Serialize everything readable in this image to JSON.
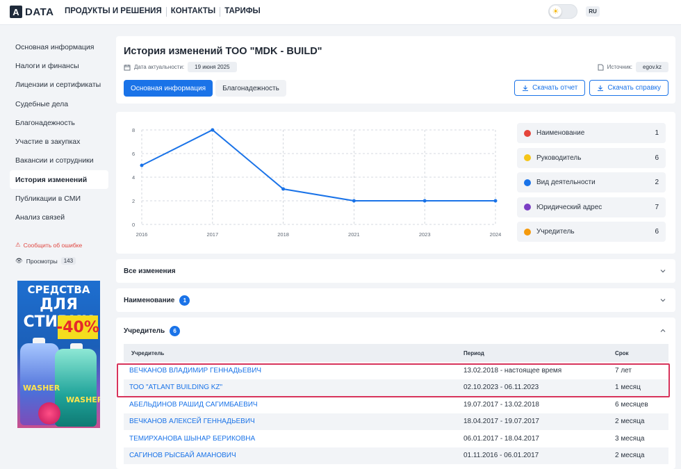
{
  "header": {
    "logo_mark": "A",
    "logo_text": "DATA",
    "nav": [
      "ПРОДУКТЫ И РЕШЕНИЯ",
      "КОНТАКТЫ",
      "ТАРИФЫ"
    ],
    "lang": "RU"
  },
  "sidebar": {
    "items": [
      {
        "label": "Основная информация",
        "active": false
      },
      {
        "label": "Налоги и финансы",
        "active": false
      },
      {
        "label": "Лицензии и сертификаты",
        "active": false
      },
      {
        "label": "Судебные дела",
        "active": false
      },
      {
        "label": "Благонадежность",
        "active": false
      },
      {
        "label": "Участие в закупках",
        "active": false
      },
      {
        "label": "Вакансии и сотрудники",
        "active": false
      },
      {
        "label": "История изменений",
        "active": true
      },
      {
        "label": "Публикации в СМИ",
        "active": false
      },
      {
        "label": "Анализ связей",
        "active": false
      }
    ],
    "report": "Сообщить об ошибке",
    "views_label": "Просмотры",
    "views_count": "143",
    "ad": {
      "line1": "СРЕДСТВА",
      "line2": "ДЛЯ СТИРКИ",
      "discount": "-40%",
      "brand": "WASHER"
    }
  },
  "main": {
    "title": "История изменений ТОО \"MDK - BUILD\"",
    "date_label": "Дата актуальности:",
    "date_value": "19 июня 2025",
    "source_label": "Источник:",
    "source_value": "egov.kz",
    "tabs": [
      "Основная информация",
      "Благонадежность"
    ],
    "download_report": "Скачать отчет",
    "download_certificate": "Скачать справку"
  },
  "chart_data": {
    "type": "line",
    "x": [
      "2016",
      "2017",
      "2018",
      "2021",
      "2023",
      "2024"
    ],
    "values": [
      5,
      8,
      3,
      2,
      2,
      2
    ],
    "ylim": [
      0,
      8
    ],
    "yticks": [
      "0",
      "2",
      "4",
      "6",
      "8"
    ],
    "grid": true,
    "color": "#1a73e8"
  },
  "legend": [
    {
      "name": "Наименование",
      "count": "1",
      "color": "#e5453b"
    },
    {
      "name": "Руководитель",
      "count": "6",
      "color": "#f5c518"
    },
    {
      "name": "Вид деятельности",
      "count": "2",
      "color": "#1a73e8"
    },
    {
      "name": "Юридический адрес",
      "count": "7",
      "color": "#7b3fc4"
    },
    {
      "name": "Учредитель",
      "count": "6",
      "color": "#f59a0c"
    }
  ],
  "sections": {
    "all_changes": "Все изменения",
    "name_section": "Наименование",
    "name_count": "1",
    "founder_section": "Учредитель",
    "founder_count": "6"
  },
  "founders_table": {
    "headers": [
      "Учредитель",
      "Период",
      "Срок"
    ],
    "rows": [
      [
        "ВЕЧКАНОВ ВЛАДИМИР ГЕННАДЬЕВИЧ",
        "13.02.2018 - настоящее время",
        "7 лет"
      ],
      [
        "ТОО \"ATLANT BUILDING KZ\"",
        "02.10.2023 - 06.11.2023",
        "1 месяц"
      ],
      [
        "АБЕЛЬДИНОВ РАШИД САГИМБАЕВИЧ",
        "19.07.2017 - 13.02.2018",
        "6 месяцев"
      ],
      [
        "ВЕЧКАНОВ АЛЕКСЕЙ ГЕННАДЬЕВИЧ",
        "18.04.2017 - 19.07.2017",
        "2 месяца"
      ],
      [
        "ТЕМИРХАНОВА ШЫНАР БЕРИКОВНА",
        "06.01.2017 - 18.04.2017",
        "3 месяца"
      ],
      [
        "САГИНОВ РЫСБАЙ АМАНОВИЧ",
        "01.11.2016 - 06.01.2017",
        "2 месяца"
      ]
    ]
  }
}
